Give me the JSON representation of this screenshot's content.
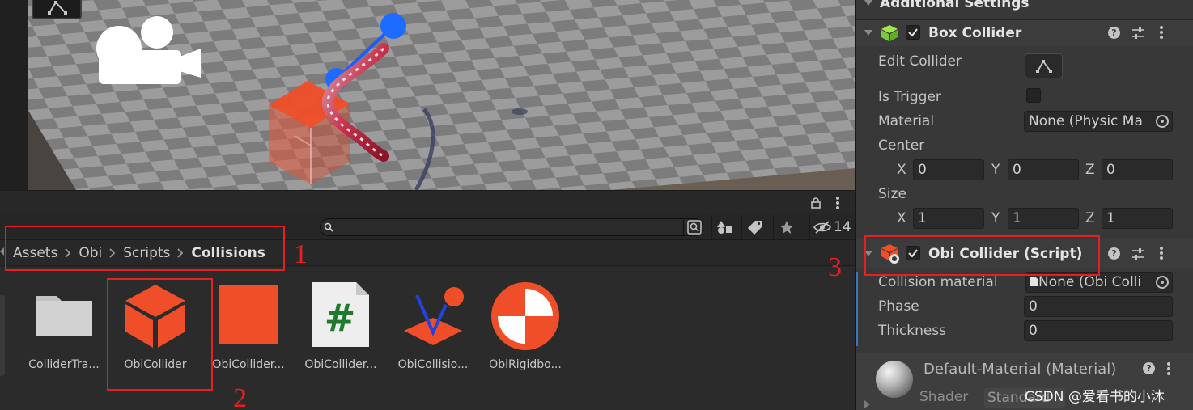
{
  "project": {
    "breadcrumb": [
      "Assets",
      "Obi",
      "Scripts",
      "Collisions"
    ],
    "search": {
      "placeholder": "",
      "value": ""
    },
    "hidden_count": "14",
    "assets": [
      {
        "name": "ColliderTra...",
        "icon": "folder-icon"
      },
      {
        "name": "ObiCollider",
        "icon": "obi-collider-cube-icon"
      },
      {
        "name": "ObiCollider...",
        "icon": "orange-square-icon"
      },
      {
        "name": "ObiCollider...",
        "icon": "csharp-script-icon"
      },
      {
        "name": "ObiCollisio...",
        "icon": "obi-collision-material-icon"
      },
      {
        "name": "ObiRigidbo...",
        "icon": "obi-rigidbody-icon"
      }
    ]
  },
  "annotations": [
    "1",
    "2",
    "3"
  ],
  "inspector": {
    "top_header": "Additional Settings",
    "box_collider": {
      "title": "Box Collider",
      "enabled": true,
      "edit_collider_label": "Edit Collider",
      "is_trigger_label": "Is Trigger",
      "is_trigger": false,
      "material_label": "Material",
      "material_value": "None (Physic Ma",
      "center_label": "Center",
      "center": {
        "x": "0",
        "y": "0",
        "z": "0"
      },
      "size_label": "Size",
      "size": {
        "x": "1",
        "y": "1",
        "z": "1"
      },
      "axis_labels": [
        "X",
        "Y",
        "Z"
      ]
    },
    "obi_collider": {
      "title": "Obi Collider (Script)",
      "enabled": true,
      "collision_material_label": "Collision material",
      "collision_material_value": "None (Obi Colli",
      "phase_label": "Phase",
      "phase_value": "0",
      "thickness_label": "Thickness",
      "thickness_value": "0"
    },
    "material": {
      "title": "Default-Material (Material)",
      "shader_label": "Shader",
      "shader_value": "Standard"
    }
  },
  "watermark": "CSDN @爱看书的小沐",
  "colors": {
    "annotation": "#e62020",
    "obi_orange": "#f04e28",
    "accent_blue": "#3a79bd"
  }
}
